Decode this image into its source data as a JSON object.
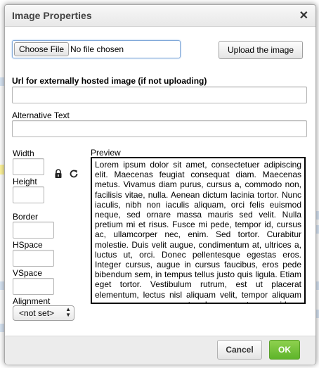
{
  "dialog": {
    "title": "Image Properties",
    "close_icon": "close-icon"
  },
  "upload": {
    "choose_label": "Choose File",
    "file_status": "No file chosen",
    "upload_label": "Upload the image"
  },
  "url": {
    "label": "Url for externally hosted image (if not uploading)",
    "value": ""
  },
  "alt": {
    "label": "Alternative Text",
    "value": ""
  },
  "dimensions": {
    "width_label": "Width",
    "height_label": "Height",
    "border_label": "Border",
    "hspace_label": "HSpace",
    "vspace_label": "VSpace",
    "alignment_label": "Alignment",
    "alignment_value": "<not set>",
    "lock_icon": "lock-icon",
    "reset_icon": "reset-size-icon"
  },
  "preview": {
    "label": "Preview",
    "text": "Lorem ipsum dolor sit amet, consectetuer adipiscing elit. Maecenas feugiat consequat diam. Maecenas metus. Vivamus diam purus, cursus a, commodo non, facilisis vitae, nulla. Aenean dictum lacinia tortor. Nunc iaculis, nibh non iaculis aliquam, orci felis euismod neque, sed ornare massa mauris sed velit. Nulla pretium mi et risus. Fusce mi pede, tempor id, cursus ac, ullamcorper nec, enim. Sed tortor. Curabitur molestie. Duis velit augue, condimentum at, ultrices a, luctus ut, orci. Donec pellentesque egestas eros. Integer cursus, augue in cursus faucibus, eros pede bibendum sem, in tempus tellus justo quis ligula. Etiam eget tortor. Vestibulum rutrum, est ut placerat elementum, lectus nisl aliquam velit, tempor aliquam eros nunc nonummy metus. In eros metus, gravida a, gravida sed, lobortis id, turpis. Ut"
  },
  "footer": {
    "cancel_label": "Cancel",
    "ok_label": "OK"
  }
}
